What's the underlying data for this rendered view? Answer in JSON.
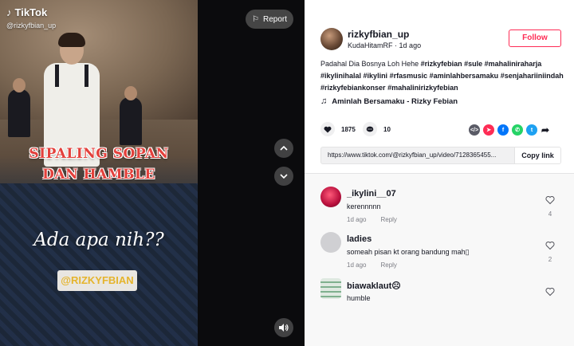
{
  "video": {
    "brand": "TikTok",
    "handle": "@rizkyfbian_up",
    "overlay_line1": "SIPALING SOPAN",
    "overlay_line2": "DAN HAMBLE",
    "overlay_italic": "Ada apa nih??",
    "overlay_tag": "@RIZKYFBIAN",
    "report_label": "Report"
  },
  "post": {
    "username": "rizkyfbian_up",
    "nickname": "KudaHitamRF",
    "time_ago": "1d ago",
    "follow_label": "Follow",
    "caption_text": "Padahal Dia Bosnya Loh Hehe ",
    "hashtags": [
      "#rizkyfebian",
      "#sule",
      "#mahaliniraharja",
      "#ikylinihalal",
      "#ikylini",
      "#rfasmusic",
      "#aminlahbersamaku",
      "#senjahariiniindah",
      "#rizkyfebiankonser",
      "#mahalinirizkyfebian"
    ],
    "music": "Aminlah Bersamaku - Rizky Febian",
    "likes": "1875",
    "comments_count": "10",
    "link": "https://www.tiktok.com/@rizkyfbian_up/video/7128365455...",
    "copy_label": "Copy link"
  },
  "share": {
    "icons": [
      "embed-icon",
      "send-to-friends-icon",
      "facebook-icon",
      "whatsapp-icon",
      "twitter-icon",
      "share-more-icon"
    ]
  },
  "comments": [
    {
      "user": "_ikylini__07",
      "text": "kerennnnn",
      "time": "1d ago",
      "reply": "Reply",
      "likes": "4"
    },
    {
      "user": "ladies",
      "text": "someah pisan kt orang bandung mah▯",
      "time": "1d ago",
      "reply": "Reply",
      "likes": "2"
    },
    {
      "user": "biawaklaut☹",
      "text": "humble",
      "time": "",
      "reply": "",
      "likes": ""
    }
  ],
  "colors": {
    "accent": "#fe2c55",
    "overlay_red": "#e3413c",
    "tag_yellow": "#e5b42c"
  }
}
